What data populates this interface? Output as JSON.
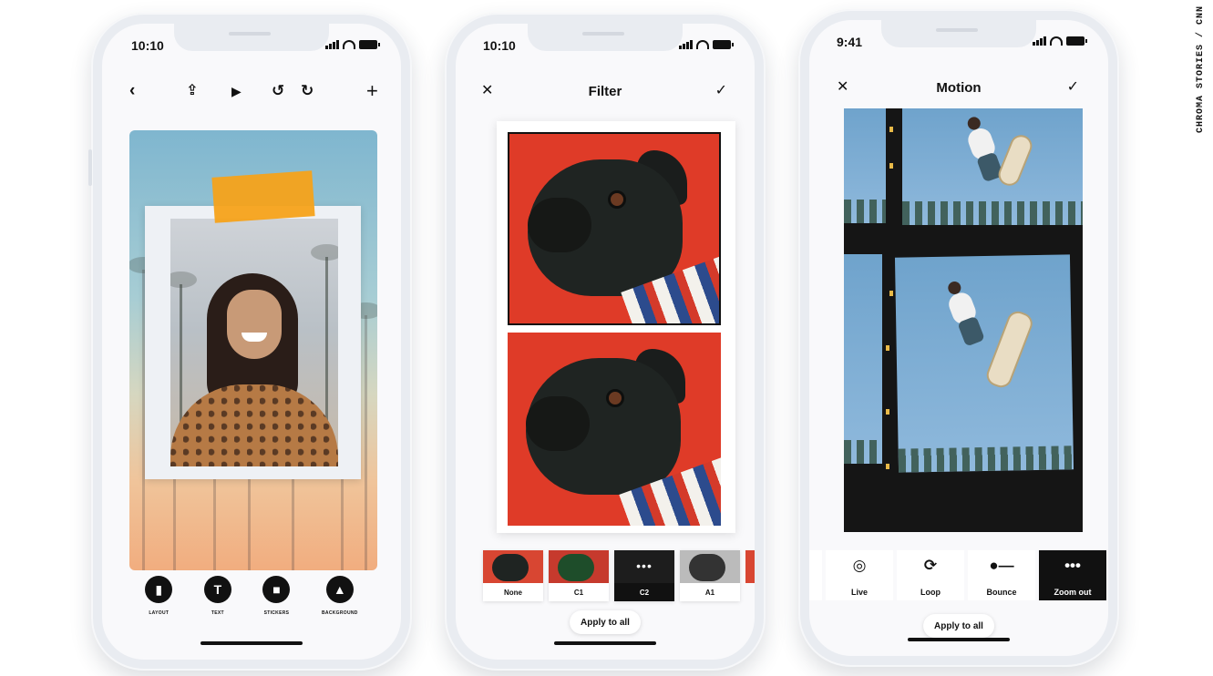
{
  "credit": "CHROMA STORIES / CNN",
  "phone1": {
    "time": "10:10",
    "toolbar": {
      "back_icon": "chevron-left-icon",
      "share_icon": "share-icon",
      "play_icon": "play-icon",
      "undo_icon": "undo-icon",
      "redo_icon": "redo-icon",
      "add_icon": "plus-icon"
    },
    "tools": [
      {
        "label": "LAYOUT",
        "icon": "layout-icon"
      },
      {
        "label": "TEXT",
        "icon": "text-icon",
        "glyph": "T"
      },
      {
        "label": "STICKERS",
        "icon": "sticker-icon"
      },
      {
        "label": "BACKGROUND",
        "icon": "background-icon"
      }
    ],
    "colors": {
      "tape": "#f6a21a",
      "sky_top": "#7fb6cf",
      "sky_bottom": "#f1ad7f"
    }
  },
  "phone2": {
    "time": "10:10",
    "title": "Filter",
    "close_icon": "close-icon",
    "confirm_icon": "check-icon",
    "filters": [
      {
        "label": "None",
        "selected": false
      },
      {
        "label": "C1",
        "selected": false
      },
      {
        "label": "C2",
        "selected": true
      },
      {
        "label": "A1",
        "selected": false
      }
    ],
    "apply_label": "Apply to all",
    "colors": {
      "photo_background": "#df3b28"
    }
  },
  "phone3": {
    "time": "9:41",
    "title": "Motion",
    "close_icon": "close-icon",
    "confirm_icon": "check-icon",
    "options": [
      {
        "label": "Live",
        "icon": "live-icon",
        "selected": false
      },
      {
        "label": "Loop",
        "icon": "loop-icon",
        "selected": false
      },
      {
        "label": "Bounce",
        "icon": "bounce-icon",
        "selected": false
      },
      {
        "label": "Zoom out",
        "icon": "zoom-out-icon",
        "selected": true
      }
    ],
    "apply_label": "Apply to all"
  }
}
